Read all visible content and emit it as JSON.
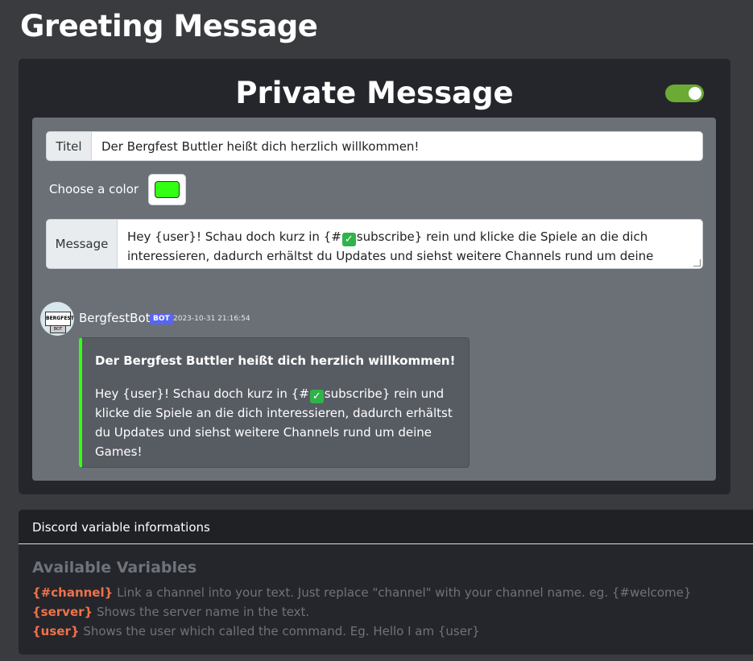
{
  "page": {
    "title": "Greeting Message"
  },
  "card": {
    "title": "Private Message",
    "toggle_on": true,
    "toggle_color": "#6aaa35"
  },
  "form": {
    "titel_label": "Titel",
    "titel_value": "Der Bergfest Buttler heißt dich herzlich willkommen!",
    "color_label": "Choose a color",
    "color_value": "#33ff15",
    "message_label": "Message",
    "message_value": {
      "before_emoji": "Hey {user}! Schau doch kurz in {#",
      "emoji": "✓",
      "after_emoji": "subscribe} rein und klicke die Spiele an die dich interessieren, dadurch erhältst du Updates und siehst weitere Channels rund um deine Games!"
    }
  },
  "preview": {
    "bot_name": "BergfestBot",
    "badge": "BOT",
    "timestamp": "2023-10-31 21:16:54",
    "avatar_text": "BERGFEST",
    "avatar_badge": "BOT",
    "embed_title": "Der Bergfest Buttler heißt dich herzlich willkommen!",
    "embed_desc_before": "Hey {user}! Schau doch kurz in {#",
    "embed_emoji": "✓",
    "embed_desc_after": "subscribe} rein und klicke die Spiele an die dich interessieren, dadurch erhältst du Updates und siehst weitere Channels rund um deine Games!",
    "embed_color": "#33ff15"
  },
  "info": {
    "header": "Discord variable informations",
    "title": "Available Variables",
    "variables": [
      {
        "name": "{#channel}",
        "desc": " Link a channel into your text. Just replace \"channel\" with your channel name. eg. {#welcome}"
      },
      {
        "name": "{server}",
        "desc": " Shows the server name in the text."
      },
      {
        "name": "{user}",
        "desc": " Shows the user which called the command. Eg. Hello I am {user}"
      }
    ]
  }
}
